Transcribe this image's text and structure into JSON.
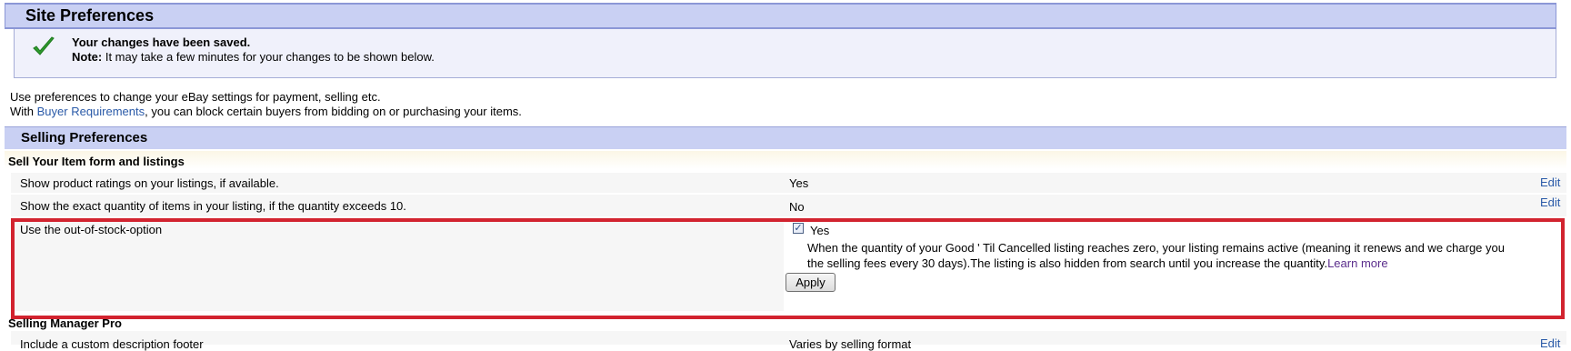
{
  "page": {
    "title": "Site Preferences"
  },
  "notice": {
    "title": "Your changes have been saved.",
    "note_label": "Note:",
    "note_text": " It may take a few minutes for your changes to be shown below.",
    "icon": "checkmark-icon",
    "icon_color": "#2e9b2e"
  },
  "intro": {
    "line1": "Use preferences to change your eBay settings for payment, selling etc.",
    "line2_prefix": "With ",
    "line2_link": "Buyer Requirements",
    "line2_suffix": ", you can block certain buyers from bidding on or purchasing your items."
  },
  "section": {
    "title": "Selling Preferences"
  },
  "subsection": {
    "title": "Sell Your Item form and listings"
  },
  "rows": [
    {
      "label": "Show product ratings on your listings, if available.",
      "value": "Yes",
      "edit": "Edit"
    },
    {
      "label": "Show the exact quantity of items in your listing, if the quantity exceeds 10.",
      "value": "No",
      "edit": "Edit"
    }
  ],
  "out_of_stock": {
    "label": "Use the out-of-stock-option",
    "checked": true,
    "yes_label": "Yes",
    "description": "When the quantity of your Good ' Til Cancelled listing reaches zero, your listing remains active (meaning it renews and we charge you the selling fees every 30 days).The listing is also hidden from search until you increase the quantity.",
    "learn_more": "Learn more",
    "apply_label": "Apply",
    "highlight_color": "#d2232f"
  },
  "subsection2": {
    "title": "Selling Manager Pro"
  },
  "partial_row": {
    "label": "Include a custom description footer",
    "value": "Varies by selling format",
    "edit": "Edit"
  },
  "colors": {
    "header_bg": "#c9d0f3",
    "link": "#2a5aa8"
  }
}
